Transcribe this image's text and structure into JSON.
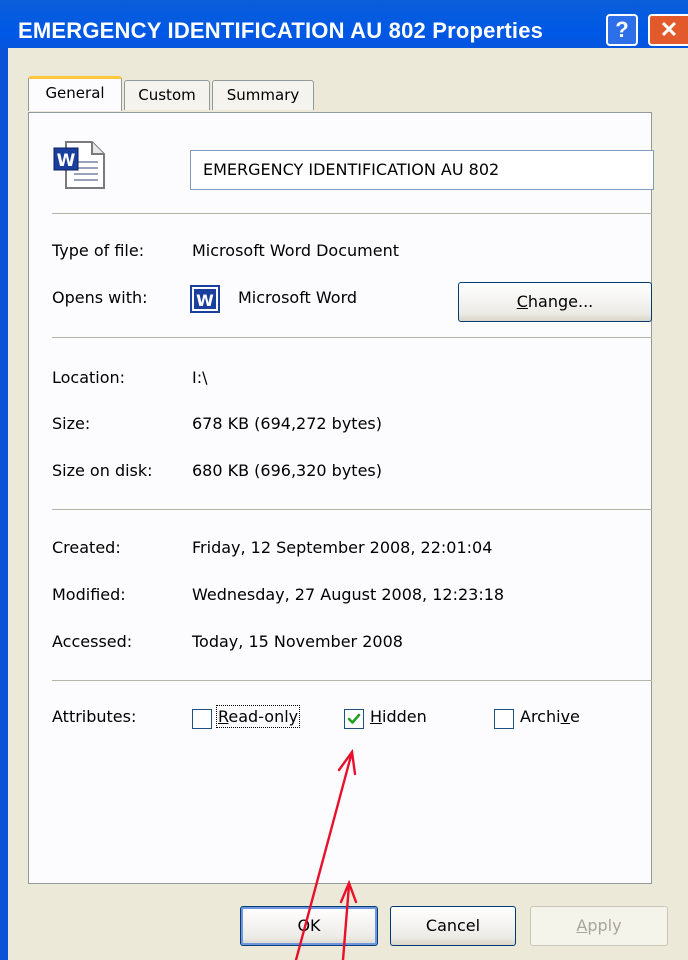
{
  "window": {
    "title": "EMERGENCY IDENTIFICATION AU 802 Properties",
    "help_glyph": "?",
    "close_glyph": "✕"
  },
  "tabs": [
    {
      "label": "General",
      "active": true
    },
    {
      "label": "Custom",
      "active": false
    },
    {
      "label": "Summary",
      "active": false
    }
  ],
  "file_name": "EMERGENCY IDENTIFICATION AU 802",
  "type_of_file": {
    "label": "Type of file:",
    "value": "Microsoft Word Document"
  },
  "opens_with": {
    "label": "Opens with:",
    "value": "Microsoft Word",
    "change_prefix": "",
    "change_underlined": "C",
    "change_rest": "hange..."
  },
  "location": {
    "label": "Location:",
    "value": "I:\\"
  },
  "size": {
    "label": "Size:",
    "value": "678 KB (694,272 bytes)"
  },
  "size_on_disk": {
    "label": "Size on disk:",
    "value": "680 KB (696,320 bytes)"
  },
  "created": {
    "label": "Created:",
    "value": "Friday, 12 September 2008, 22:01:04"
  },
  "modified": {
    "label": "Modified:",
    "value": "Wednesday, 27 August 2008, 12:23:18"
  },
  "accessed": {
    "label": "Accessed:",
    "value": "Today, 15 November 2008"
  },
  "attributes": {
    "label": "Attributes:",
    "read_only": {
      "u": "R",
      "rest": "ead-only",
      "checked": false
    },
    "hidden": {
      "u": "H",
      "rest": "idden",
      "checked": true
    },
    "archive": {
      "pre": "Archi",
      "u": "v",
      "post": "e",
      "checked": false
    }
  },
  "buttons": {
    "ok": "OK",
    "cancel": "Cancel",
    "apply_u": "A",
    "apply_rest": "pply"
  },
  "colors": {
    "titlebar": "#0058e6",
    "dialog_bg": "#ece9d8",
    "active_tab_accent": "#ffc73c",
    "check_mark": "#21a121",
    "annotation_arrow": "#e8102a"
  }
}
